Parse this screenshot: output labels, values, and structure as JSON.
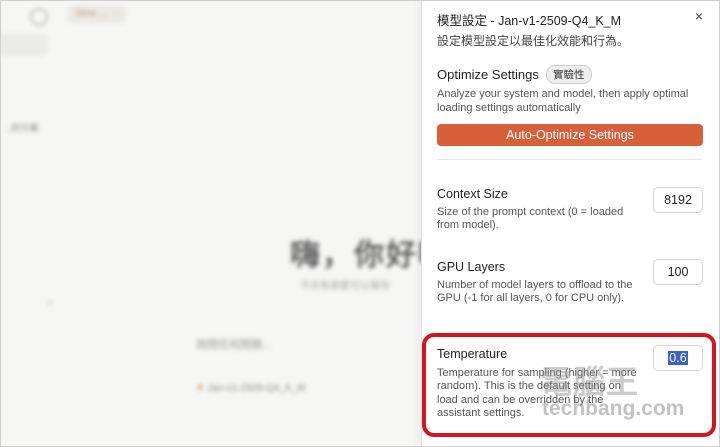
{
  "background": {
    "tab_label": "New ...",
    "sidebar_text": "...的方案",
    "greeting": "嗨，你好嗎",
    "greeting_sub": "今天有甚麼可以幫你",
    "input_placeholder": "詢問任何問題...",
    "model_label": "Jan-v1-2509-Q4_K_M"
  },
  "panel": {
    "title": "模型設定 - Jan-v1-2509-Q4_K_M",
    "subtitle": "設定模型設定以最佳化效能和行為。",
    "close": "×",
    "optimize": {
      "title": "Optimize Settings",
      "badge": "實驗性",
      "description": "Analyze your system and model, then apply optimal loading settings automatically",
      "button": "Auto-Optimize Settings"
    },
    "settings": [
      {
        "title": "Context Size",
        "description": "Size of the prompt context (0 = loaded from model).",
        "value": "8192"
      },
      {
        "title": "GPU Layers",
        "description": "Number of model layers to offload to the GPU (-1 for all layers, 0 for CPU only).",
        "value": "100"
      },
      {
        "title": "Temperature",
        "description": "Temperature for sampling (higher = more random). This is the default setting on load and can be overridden by the assistant settings.",
        "value": "0.6"
      }
    ]
  },
  "watermark": {
    "main": "電腦王",
    "site": "techbang.com"
  },
  "colors": {
    "accent": "#d7603a",
    "highlight": "#d4141e",
    "selection": "#3b63c4"
  }
}
